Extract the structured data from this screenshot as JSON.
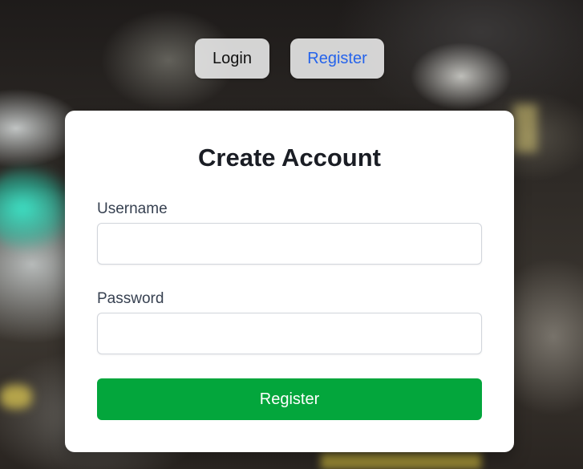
{
  "nav": {
    "login_label": "Login",
    "register_label": "Register",
    "active_tab": "Register"
  },
  "form": {
    "title": "Create Account",
    "username_label": "Username",
    "username_value": "",
    "password_label": "Password",
    "password_value": "",
    "submit_label": "Register"
  },
  "colors": {
    "accent_link": "#2563eb",
    "submit_button": "#03a63c",
    "card_background": "#ffffff"
  }
}
